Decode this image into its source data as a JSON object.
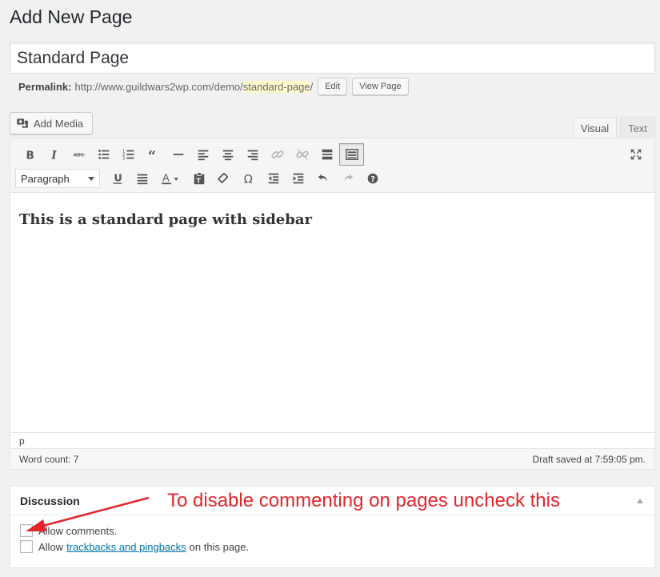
{
  "page": {
    "heading": "Add New Page"
  },
  "title_field": {
    "value": "Standard Page"
  },
  "permalink": {
    "label": "Permalink:",
    "base_url": "http://www.guildwars2wp.com/demo/",
    "slug": "standard-page",
    "trailing": "/",
    "edit_label": "Edit",
    "view_label": "View Page"
  },
  "media": {
    "add_label": "Add Media"
  },
  "editor_tabs": {
    "visual": "Visual",
    "text": "Text"
  },
  "toolbar": {
    "row1_icons": [
      "bold-icon",
      "italic-icon",
      "strikethrough-icon",
      "bullet-list-icon",
      "numbered-list-icon",
      "blockquote-icon",
      "horizontal-rule-icon",
      "align-left-icon",
      "align-center-icon",
      "align-right-icon",
      "link-icon",
      "unlink-icon",
      "read-more-icon",
      "toolbar-toggle-icon"
    ],
    "format_select": "Paragraph",
    "row2_icons": [
      "underline-icon",
      "justify-icon",
      "text-color-icon",
      "paste-text-icon",
      "clear-formatting-icon",
      "special-character-icon",
      "outdent-icon",
      "indent-icon",
      "undo-icon",
      "redo-icon",
      "help-icon"
    ]
  },
  "content": {
    "text": "This is  a standard page with sidebar"
  },
  "path": {
    "text": "p"
  },
  "status": {
    "word_count": "Word count: 7",
    "draft_saved": "Draft saved at 7:59:05 pm."
  },
  "discussion": {
    "title": "Discussion",
    "allow_comments": "Allow comments.",
    "allow_prefix": "Allow",
    "trackbacks_link": "trackbacks and pingbacks",
    "allow_suffix": "on this page."
  },
  "annotation": {
    "text": "To disable commenting on pages uncheck this",
    "color": "#e3262b"
  }
}
